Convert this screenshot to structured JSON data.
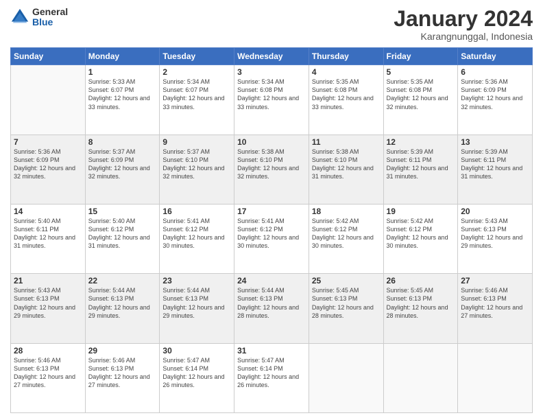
{
  "logo": {
    "general": "General",
    "blue": "Blue"
  },
  "title": "January 2024",
  "subtitle": "Karangnunggal, Indonesia",
  "weekdays": [
    "Sunday",
    "Monday",
    "Tuesday",
    "Wednesday",
    "Thursday",
    "Friday",
    "Saturday"
  ],
  "weeks": [
    [
      {
        "day": null,
        "sunrise": null,
        "sunset": null,
        "daylight": null
      },
      {
        "day": "1",
        "sunrise": "Sunrise: 5:33 AM",
        "sunset": "Sunset: 6:07 PM",
        "daylight": "Daylight: 12 hours and 33 minutes."
      },
      {
        "day": "2",
        "sunrise": "Sunrise: 5:34 AM",
        "sunset": "Sunset: 6:07 PM",
        "daylight": "Daylight: 12 hours and 33 minutes."
      },
      {
        "day": "3",
        "sunrise": "Sunrise: 5:34 AM",
        "sunset": "Sunset: 6:08 PM",
        "daylight": "Daylight: 12 hours and 33 minutes."
      },
      {
        "day": "4",
        "sunrise": "Sunrise: 5:35 AM",
        "sunset": "Sunset: 6:08 PM",
        "daylight": "Daylight: 12 hours and 33 minutes."
      },
      {
        "day": "5",
        "sunrise": "Sunrise: 5:35 AM",
        "sunset": "Sunset: 6:08 PM",
        "daylight": "Daylight: 12 hours and 32 minutes."
      },
      {
        "day": "6",
        "sunrise": "Sunrise: 5:36 AM",
        "sunset": "Sunset: 6:09 PM",
        "daylight": "Daylight: 12 hours and 32 minutes."
      }
    ],
    [
      {
        "day": "7",
        "sunrise": "Sunrise: 5:36 AM",
        "sunset": "Sunset: 6:09 PM",
        "daylight": "Daylight: 12 hours and 32 minutes."
      },
      {
        "day": "8",
        "sunrise": "Sunrise: 5:37 AM",
        "sunset": "Sunset: 6:09 PM",
        "daylight": "Daylight: 12 hours and 32 minutes."
      },
      {
        "day": "9",
        "sunrise": "Sunrise: 5:37 AM",
        "sunset": "Sunset: 6:10 PM",
        "daylight": "Daylight: 12 hours and 32 minutes."
      },
      {
        "day": "10",
        "sunrise": "Sunrise: 5:38 AM",
        "sunset": "Sunset: 6:10 PM",
        "daylight": "Daylight: 12 hours and 32 minutes."
      },
      {
        "day": "11",
        "sunrise": "Sunrise: 5:38 AM",
        "sunset": "Sunset: 6:10 PM",
        "daylight": "Daylight: 12 hours and 31 minutes."
      },
      {
        "day": "12",
        "sunrise": "Sunrise: 5:39 AM",
        "sunset": "Sunset: 6:11 PM",
        "daylight": "Daylight: 12 hours and 31 minutes."
      },
      {
        "day": "13",
        "sunrise": "Sunrise: 5:39 AM",
        "sunset": "Sunset: 6:11 PM",
        "daylight": "Daylight: 12 hours and 31 minutes."
      }
    ],
    [
      {
        "day": "14",
        "sunrise": "Sunrise: 5:40 AM",
        "sunset": "Sunset: 6:11 PM",
        "daylight": "Daylight: 12 hours and 31 minutes."
      },
      {
        "day": "15",
        "sunrise": "Sunrise: 5:40 AM",
        "sunset": "Sunset: 6:12 PM",
        "daylight": "Daylight: 12 hours and 31 minutes."
      },
      {
        "day": "16",
        "sunrise": "Sunrise: 5:41 AM",
        "sunset": "Sunset: 6:12 PM",
        "daylight": "Daylight: 12 hours and 30 minutes."
      },
      {
        "day": "17",
        "sunrise": "Sunrise: 5:41 AM",
        "sunset": "Sunset: 6:12 PM",
        "daylight": "Daylight: 12 hours and 30 minutes."
      },
      {
        "day": "18",
        "sunrise": "Sunrise: 5:42 AM",
        "sunset": "Sunset: 6:12 PM",
        "daylight": "Daylight: 12 hours and 30 minutes."
      },
      {
        "day": "19",
        "sunrise": "Sunrise: 5:42 AM",
        "sunset": "Sunset: 6:12 PM",
        "daylight": "Daylight: 12 hours and 30 minutes."
      },
      {
        "day": "20",
        "sunrise": "Sunrise: 5:43 AM",
        "sunset": "Sunset: 6:13 PM",
        "daylight": "Daylight: 12 hours and 29 minutes."
      }
    ],
    [
      {
        "day": "21",
        "sunrise": "Sunrise: 5:43 AM",
        "sunset": "Sunset: 6:13 PM",
        "daylight": "Daylight: 12 hours and 29 minutes."
      },
      {
        "day": "22",
        "sunrise": "Sunrise: 5:44 AM",
        "sunset": "Sunset: 6:13 PM",
        "daylight": "Daylight: 12 hours and 29 minutes."
      },
      {
        "day": "23",
        "sunrise": "Sunrise: 5:44 AM",
        "sunset": "Sunset: 6:13 PM",
        "daylight": "Daylight: 12 hours and 29 minutes."
      },
      {
        "day": "24",
        "sunrise": "Sunrise: 5:44 AM",
        "sunset": "Sunset: 6:13 PM",
        "daylight": "Daylight: 12 hours and 28 minutes."
      },
      {
        "day": "25",
        "sunrise": "Sunrise: 5:45 AM",
        "sunset": "Sunset: 6:13 PM",
        "daylight": "Daylight: 12 hours and 28 minutes."
      },
      {
        "day": "26",
        "sunrise": "Sunrise: 5:45 AM",
        "sunset": "Sunset: 6:13 PM",
        "daylight": "Daylight: 12 hours and 28 minutes."
      },
      {
        "day": "27",
        "sunrise": "Sunrise: 5:46 AM",
        "sunset": "Sunset: 6:13 PM",
        "daylight": "Daylight: 12 hours and 27 minutes."
      }
    ],
    [
      {
        "day": "28",
        "sunrise": "Sunrise: 5:46 AM",
        "sunset": "Sunset: 6:13 PM",
        "daylight": "Daylight: 12 hours and 27 minutes."
      },
      {
        "day": "29",
        "sunrise": "Sunrise: 5:46 AM",
        "sunset": "Sunset: 6:13 PM",
        "daylight": "Daylight: 12 hours and 27 minutes."
      },
      {
        "day": "30",
        "sunrise": "Sunrise: 5:47 AM",
        "sunset": "Sunset: 6:14 PM",
        "daylight": "Daylight: 12 hours and 26 minutes."
      },
      {
        "day": "31",
        "sunrise": "Sunrise: 5:47 AM",
        "sunset": "Sunset: 6:14 PM",
        "daylight": "Daylight: 12 hours and 26 minutes."
      },
      {
        "day": null,
        "sunrise": null,
        "sunset": null,
        "daylight": null
      },
      {
        "day": null,
        "sunrise": null,
        "sunset": null,
        "daylight": null
      },
      {
        "day": null,
        "sunrise": null,
        "sunset": null,
        "daylight": null
      }
    ]
  ]
}
